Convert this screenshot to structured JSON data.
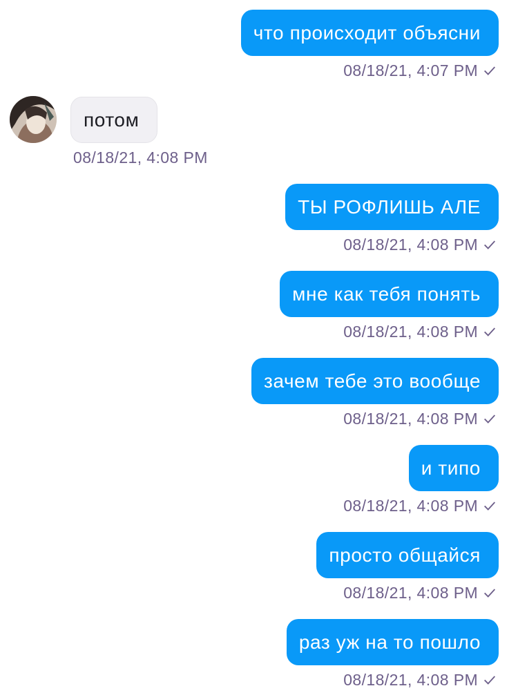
{
  "messages": [
    {
      "direction": "out",
      "text": "что происходит объясни",
      "time": "08/18/21, 4:07 PM",
      "read_icon": "checkmark-icon"
    },
    {
      "direction": "in",
      "text": "потом",
      "time": "08/18/21, 4:08 PM",
      "avatar_icon": "user-avatar"
    },
    {
      "direction": "out",
      "text": "ТЫ РОФЛИШЬ АЛЕ",
      "time": "08/18/21, 4:08 PM",
      "read_icon": "checkmark-icon"
    },
    {
      "direction": "out",
      "text": "мне как тебя понять",
      "time": "08/18/21, 4:08 PM",
      "read_icon": "checkmark-icon"
    },
    {
      "direction": "out",
      "text": "зачем тебе это вообще",
      "time": "08/18/21, 4:08 PM",
      "read_icon": "checkmark-icon"
    },
    {
      "direction": "out",
      "text": "и типо",
      "time": "08/18/21, 4:08 PM",
      "read_icon": "checkmark-icon"
    },
    {
      "direction": "out",
      "text": "просто общайся",
      "time": "08/18/21, 4:08 PM",
      "read_icon": "checkmark-icon"
    },
    {
      "direction": "out",
      "text": "раз уж на то пошло",
      "time": "08/18/21, 4:08 PM",
      "read_icon": "checkmark-icon"
    }
  ],
  "colors": {
    "outgoing_bubble": "#0999f8",
    "incoming_bubble": "#f1f0f4",
    "timestamp": "#6d5f8a"
  }
}
